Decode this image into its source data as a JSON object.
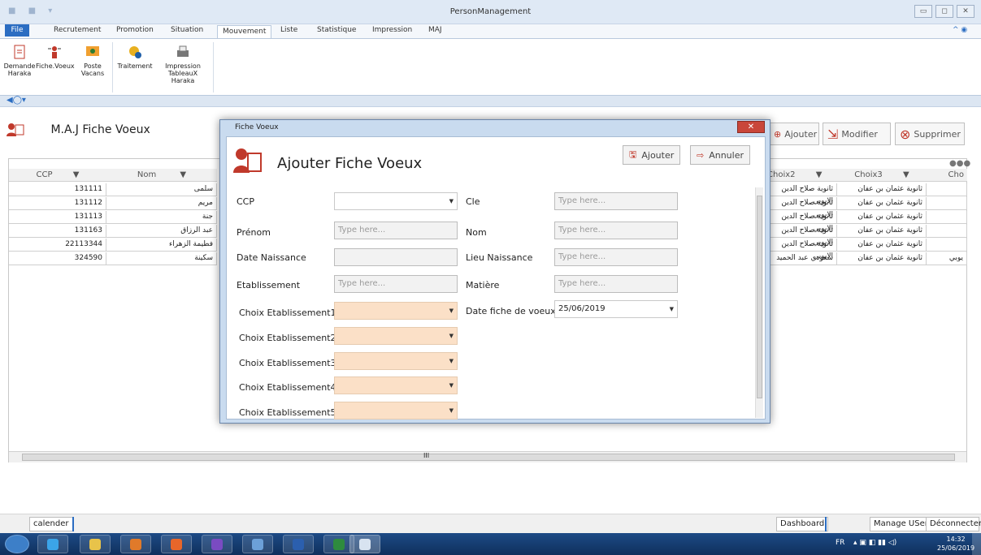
{
  "window": {
    "title": "PersonManagement"
  },
  "ribbon_tabs": [
    "File",
    "Recrutement",
    "Promotion",
    "Situation",
    "Mouvement",
    "Liste",
    "Statistique",
    "Impression",
    "MAJ"
  ],
  "ribbon_buttons": {
    "demande_haraka": "Demande Haraka",
    "fiche_voeux": "Fiche.Voeux",
    "poste_vacans": "Poste Vacans",
    "traitement": "Traitement",
    "impression_tableaux": "Impression TableauX Haraka"
  },
  "page": {
    "title": "M.A.J Fiche Voeux",
    "actions": {
      "ajouter": "Ajouter",
      "modifier": "Modifier",
      "supprimer": "Supprimer"
    },
    "grid_headers": {
      "ccp": "CCP",
      "nom": "Nom",
      "choix2": "Choix2",
      "choix3": "Choix3",
      "cho": "Cho"
    },
    "rows": [
      {
        "ccp": "131111",
        "nom": "سلمى",
        "choix2": "ثانوية صلاح الدين الايوبي",
        "choix3": "ثانوية عثمان بن عفان",
        "cho": ""
      },
      {
        "ccp": "131112",
        "nom": "مريم",
        "choix2": "ثانوية صلاح الدين الايوبي",
        "choix3": "ثانوية عثمان بن عفان",
        "cho": ""
      },
      {
        "ccp": "131113",
        "nom": "جنة",
        "choix2": "ثانوية صلاح الدين الايوبي",
        "choix3": "ثانوية عثمان بن عفان",
        "cho": ""
      },
      {
        "ccp": "131163",
        "nom": "عبد الرزاق",
        "choix2": "ثانوية صلاح الدين الايوبي",
        "choix3": "ثانوية عثمان بن عفان",
        "cho": ""
      },
      {
        "ccp": "22113344",
        "nom": "فطيمة الزهراء",
        "choix2": "ثانوية صلاح الدين الايوبي",
        "choix3": "ثانوية عثمان بن عفان",
        "cho": ""
      },
      {
        "ccp": "324590",
        "nom": "سكينة",
        "choix2": "سعودي عبد الحميد",
        "choix3": "ثانوية عثمان بن عفان",
        "cho": "يوبي"
      }
    ],
    "scroll_mark": "III"
  },
  "dialog": {
    "window_title": "Fiche Voeux",
    "heading": "Ajouter Fiche Voeux",
    "btn_ajouter": "Ajouter",
    "btn_annuler": "Annuler",
    "labels": {
      "ccp": "CCP",
      "cle": "Cle",
      "prenom": "Prénom",
      "nom": "Nom",
      "date_naissance": "Date Naissance",
      "lieu_naissance": "Lieu Naissance",
      "etablissement": "Etablissement",
      "matiere": "Matière",
      "choix1": "Choix Etablissement1",
      "choix2": "Choix Etablissement2",
      "choix3": "Choix Etablissement3",
      "choix4": "Choix Etablissement4",
      "choix5": "Choix Etablissement5",
      "date_fiche": "Date fiche de voeux"
    },
    "placeholder": "Type here...",
    "date_fiche_value": "25/06/2019"
  },
  "statusbar": {
    "calender": "calender",
    "dashboard": "Dashboard",
    "manage_users": "Manage USers",
    "deconnecter": "Déconnecter"
  },
  "taskbar": {
    "lang": "FR",
    "time": "14:32",
    "date": "25/06/2019"
  }
}
